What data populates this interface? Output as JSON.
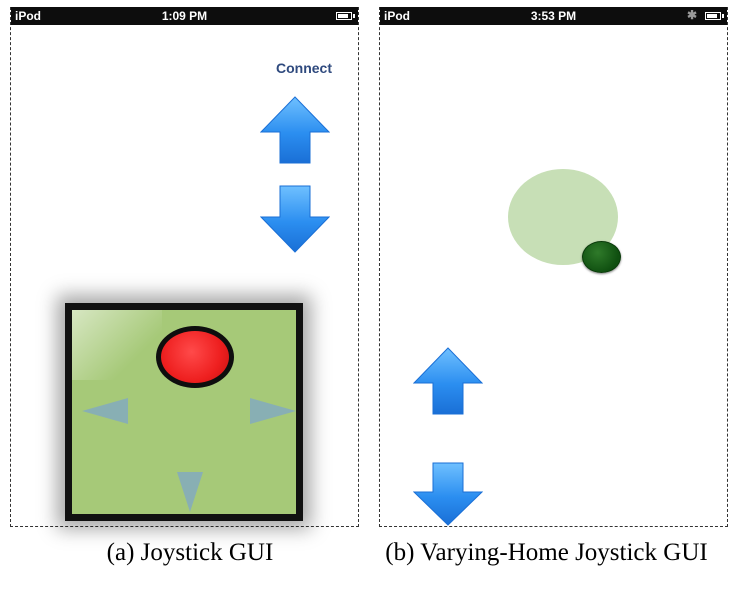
{
  "phone_a": {
    "status": {
      "carrier": "iPod",
      "time": "1:09 PM",
      "battery_icon": "battery-icon"
    },
    "connect_label": "Connect",
    "up_icon": "up-arrow-icon",
    "down_icon": "down-arrow-icon",
    "joystick": {
      "knob_color": "#ee1f1f",
      "pad_color": "#a6c978"
    }
  },
  "phone_b": {
    "status": {
      "carrier": "iPod",
      "time": "3:53 PM",
      "bluetooth_glyph": "✱",
      "battery_icon": "battery-icon"
    },
    "home_zone_color": "#c7dfb6",
    "knob_color": "#0f4f10",
    "up_icon": "up-arrow-icon",
    "down_icon": "down-arrow-icon"
  },
  "colors": {
    "arrow": "#2b8ef0",
    "status_bar": "#0d0d0d",
    "connect": "#2f4a7e"
  },
  "captions": {
    "a": "(a) Joystick GUI",
    "b": "(b) Varying-Home Joystick GUI"
  }
}
